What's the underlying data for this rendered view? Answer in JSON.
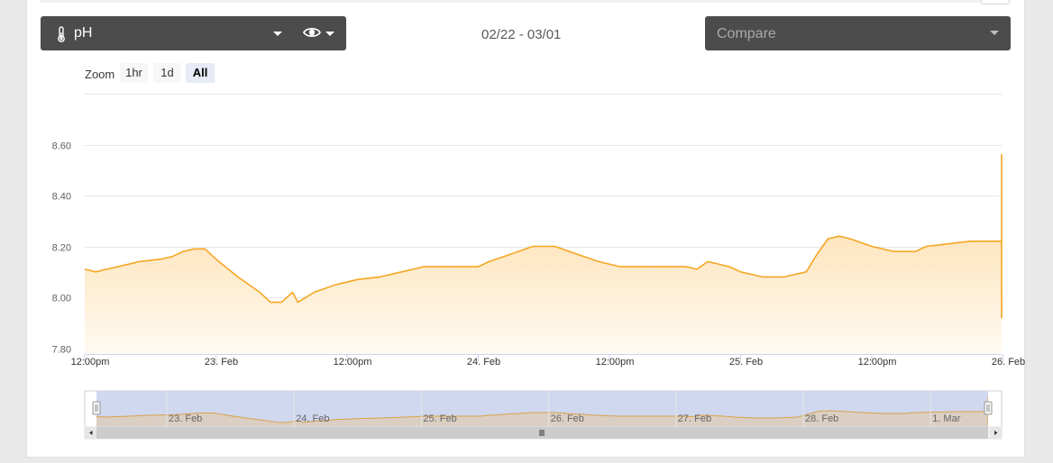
{
  "header": {
    "sensor_label": "pH",
    "date_range": "02/22 - 03/01",
    "compare_placeholder": "Compare"
  },
  "zoom": {
    "label": "Zoom",
    "buttons": [
      "1hr",
      "1d",
      "All"
    ],
    "active": "All"
  },
  "colors": {
    "line": "#f5a623",
    "fill_top": "#fdd79a",
    "fill_bottom": "#fffaf2",
    "navigator_mask": "#cdd6ee",
    "dark_control": "#4b4c4b"
  },
  "icons": {
    "sensor": "thermometer-icon",
    "visibility": "eye-icon"
  },
  "chart_data": {
    "type": "area",
    "title": "",
    "xlabel": "",
    "ylabel": "",
    "ylim": [
      7.8,
      8.6
    ],
    "y_ticks": [
      "7.80",
      "8.00",
      "8.20",
      "8.40",
      "8.60"
    ],
    "grid": true,
    "x_start": "2022-02-22 12:00",
    "x_end": "2022-03-01 22:00",
    "x_ticks": [
      "12:00pm",
      "23. Feb",
      "12:00pm",
      "24. Feb",
      "12:00pm",
      "25. Feb",
      "12:00pm",
      "26. Feb",
      "12:00pm",
      "27. Feb",
      "12:00pm",
      "28. Feb",
      "12:00pm",
      "1. Mar"
    ],
    "navigator_ticks": [
      "23. Feb",
      "24. Feb",
      "25. Feb",
      "26. Feb",
      "27. Feb",
      "28. Feb",
      "1. Mar"
    ],
    "series": [
      {
        "values": [
          [
            "2022-02-22 12:00",
            8.11
          ],
          [
            "2022-02-22 13:00",
            8.1
          ],
          [
            "2022-02-22 14:00",
            8.11
          ],
          [
            "2022-02-22 15:00",
            8.12
          ],
          [
            "2022-02-22 16:00",
            8.13
          ],
          [
            "2022-02-22 17:00",
            8.14
          ],
          [
            "2022-02-22 19:00",
            8.15
          ],
          [
            "2022-02-22 20:00",
            8.16
          ],
          [
            "2022-02-22 21:00",
            8.18
          ],
          [
            "2022-02-22 22:00",
            8.19
          ],
          [
            "2022-02-22 23:00",
            8.19
          ],
          [
            "2022-02-23 00:00",
            8.15
          ],
          [
            "2022-02-23 02:00",
            8.08
          ],
          [
            "2022-02-23 04:00",
            8.02
          ],
          [
            "2022-02-23 05:00",
            7.98
          ],
          [
            "2022-02-23 06:00",
            7.98
          ],
          [
            "2022-02-23 07:00",
            8.02
          ],
          [
            "2022-02-23 07:30",
            7.98
          ],
          [
            "2022-02-23 09:00",
            8.02
          ],
          [
            "2022-02-23 11:00",
            8.05
          ],
          [
            "2022-02-23 13:00",
            8.07
          ],
          [
            "2022-02-23 15:00",
            8.08
          ],
          [
            "2022-02-23 17:00",
            8.1
          ],
          [
            "2022-02-23 19:00",
            8.12
          ],
          [
            "2022-02-24 00:00",
            8.12
          ],
          [
            "2022-02-24 01:00",
            8.14
          ],
          [
            "2022-02-24 03:00",
            8.17
          ],
          [
            "2022-02-24 05:00",
            8.2
          ],
          [
            "2022-02-24 07:00",
            8.2
          ],
          [
            "2022-02-24 09:00",
            8.17
          ],
          [
            "2022-02-24 11:00",
            8.14
          ],
          [
            "2022-02-24 13:00",
            8.12
          ],
          [
            "2022-02-24 19:00",
            8.12
          ],
          [
            "2022-02-24 20:00",
            8.11
          ],
          [
            "2022-02-24 21:00",
            8.14
          ],
          [
            "2022-02-24 23:00",
            8.12
          ],
          [
            "2022-02-25 00:00",
            8.1
          ],
          [
            "2022-02-25 02:00",
            8.08
          ],
          [
            "2022-02-25 04:00",
            8.08
          ],
          [
            "2022-02-25 06:00",
            8.1
          ],
          [
            "2022-02-25 07:00",
            8.17
          ],
          [
            "2022-02-25 08:00",
            8.23
          ],
          [
            "2022-02-25 09:00",
            8.24
          ],
          [
            "2022-02-25 10:00",
            8.23
          ],
          [
            "2022-02-25 12:00",
            8.2
          ],
          [
            "2022-02-25 14:00",
            8.18
          ],
          [
            "2022-02-25 16:00",
            8.18
          ],
          [
            "2022-02-25 17:00",
            8.2
          ],
          [
            "2022-02-25 19:00",
            8.21
          ],
          [
            "2022-02-25 21:00",
            8.22
          ],
          [
            "2022-02-26 01:00",
            8.22
          ],
          [
            "2022-02-26 02:00",
            8.23
          ],
          [
            "2022-02-26 03:00",
            8.15
          ],
          [
            "2022-02-26 04:00",
            8.1
          ],
          [
            "2022-02-26 05:00",
            8.08
          ],
          [
            "2022-02-26 07:00",
            8.08
          ],
          [
            "2022-02-26 08:00",
            8.1
          ],
          [
            "2022-02-26 09:00",
            8.12
          ],
          [
            "2022-02-26 10:00",
            8.12
          ],
          [
            "2022-02-26 11:00",
            8.14
          ],
          [
            "2022-02-26 11:30",
            8.31
          ],
          [
            "2022-02-26 12:00",
            8.26
          ],
          [
            "2022-02-26 12:30",
            8.29
          ],
          [
            "2022-02-26 13:00",
            8.27
          ],
          [
            "2022-02-26 15:00",
            8.2
          ],
          [
            "2022-02-26 17:00",
            8.14
          ],
          [
            "2022-02-26 19:00",
            8.12
          ],
          [
            "2022-02-26 21:00",
            8.1
          ],
          [
            "2022-02-26 23:00",
            8.12
          ],
          [
            "2022-02-27 01:00",
            8.14
          ],
          [
            "2022-02-27 03:00",
            8.16
          ],
          [
            "2022-02-27 05:00",
            8.17
          ],
          [
            "2022-02-27 07:00",
            8.18
          ],
          [
            "2022-02-27 08:00",
            8.08
          ],
          [
            "2022-02-27 09:00",
            8.04
          ],
          [
            "2022-02-27 11:00",
            8.03
          ],
          [
            "2022-02-27 13:00",
            8.03
          ],
          [
            "2022-02-27 14:00",
            8.05
          ],
          [
            "2022-02-27 15:00",
            8.01
          ],
          [
            "2022-02-27 16:00",
            8.1
          ],
          [
            "2022-02-27 17:00",
            8.08
          ],
          [
            "2022-02-27 18:00",
            8.05
          ],
          [
            "2022-02-27 19:00",
            8.0
          ],
          [
            "2022-02-27 20:00",
            7.92
          ],
          [
            "2022-02-27 21:00",
            7.93
          ],
          [
            "2022-02-27 22:00",
            7.95
          ],
          [
            "2022-02-27 23:00",
            7.96
          ],
          [
            "2022-02-28 01:00",
            8.0
          ],
          [
            "2022-02-28 03:00",
            8.04
          ],
          [
            "2022-02-28 05:00",
            8.1
          ],
          [
            "2022-02-28 07:00",
            8.16
          ],
          [
            "2022-02-28 09:00",
            8.2
          ],
          [
            "2022-02-28 10:00",
            8.19
          ],
          [
            "2022-02-28 11:00",
            8.1
          ],
          [
            "2022-02-28 12:00",
            8.08
          ],
          [
            "2022-02-28 13:00",
            8.12
          ],
          [
            "2022-02-28 14:00",
            8.12
          ],
          [
            "2022-02-28 16:00",
            8.12
          ],
          [
            "2022-02-28 17:00",
            8.28
          ],
          [
            "2022-02-28 18:00",
            8.27
          ],
          [
            "2022-02-28 19:00",
            8.23
          ],
          [
            "2022-02-28 22:00",
            8.23
          ],
          [
            "2022-02-28 23:00",
            8.21
          ],
          [
            "2022-03-01 00:00",
            8.2
          ],
          [
            "2022-03-01 01:00",
            8.22
          ],
          [
            "2022-03-01 04:00",
            8.21
          ],
          [
            "2022-03-01 05:00",
            8.18
          ],
          [
            "2022-03-01 07:00",
            8.18
          ],
          [
            "2022-03-01 08:00",
            8.06
          ],
          [
            "2022-03-01 09:00",
            8.04
          ],
          [
            "2022-03-01 11:00",
            8.04
          ],
          [
            "2022-03-01 12:00",
            8.07
          ],
          [
            "2022-03-01 13:00",
            8.1
          ],
          [
            "2022-03-01 14:00",
            8.13
          ],
          [
            "2022-03-01 15:00",
            8.26
          ],
          [
            "2022-03-01 16:00",
            8.45
          ],
          [
            "2022-03-01 17:00",
            8.55
          ],
          [
            "2022-03-01 18:00",
            8.56
          ],
          [
            "2022-03-01 19:00",
            8.48
          ],
          [
            "2022-03-01 20:00",
            8.5
          ],
          [
            "2022-03-01 21:00",
            8.47
          ],
          [
            "2022-03-01 22:00",
            8.45
          ],
          [
            "2022-03-01 23:00",
            8.46
          ],
          [
            "2022-03-02 00:00",
            8.43
          ],
          [
            "2022-03-02 01:00",
            8.42
          ],
          [
            "2022-03-02 02:00",
            8.41
          ],
          [
            "2022-03-02 03:00",
            8.43
          ],
          [
            "2022-03-02 04:00",
            8.44
          ],
          [
            "2022-03-02 05:00",
            8.4
          ],
          [
            "2022-03-02 06:00",
            8.44
          ],
          [
            "2022-03-02 06:30",
            8.29
          ],
          [
            "2022-03-02 07:00",
            8.03
          ],
          [
            "2022-03-02 07:30",
            7.99
          ]
        ]
      }
    ]
  }
}
